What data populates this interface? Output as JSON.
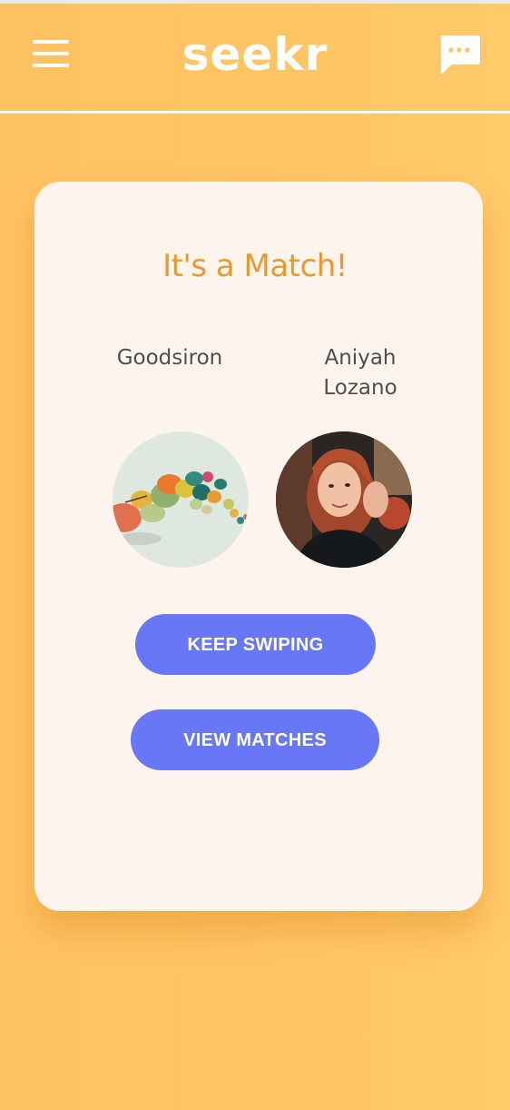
{
  "header": {
    "logo_text": "seekr",
    "menu_icon": "hamburger-menu-icon",
    "chat_icon": "chat-bubble-icon"
  },
  "match": {
    "title": "It's a Match!",
    "user_name": "Goodsiron",
    "match_name": "Aniyah\nLozano",
    "user_avatar": "abstract-art-avatar",
    "match_avatar": "woman-photo-avatar"
  },
  "buttons": {
    "keep_swiping": "KEEP SWIPING",
    "view_matches": "VIEW MATCHES"
  },
  "colors": {
    "background": "#ffc464",
    "card": "#fdf4ee",
    "title": "#e79a2d",
    "button": "#6877f6",
    "text": "#4e4e4e"
  }
}
